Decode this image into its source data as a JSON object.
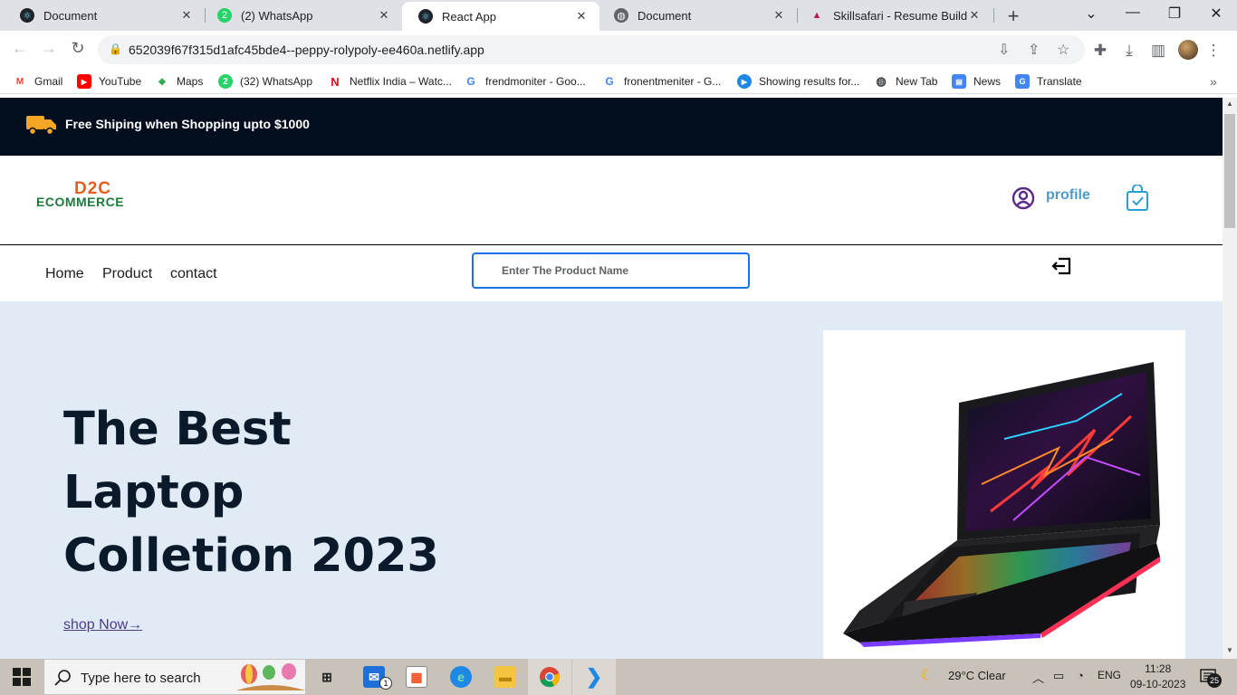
{
  "browser": {
    "tabs": [
      {
        "label": "Document",
        "favicon": "react-icon",
        "active": false
      },
      {
        "label": "(2) WhatsApp",
        "favicon": "whatsapp-icon",
        "active": false
      },
      {
        "label": "React App",
        "favicon": "react-icon",
        "active": true
      },
      {
        "label": "Document",
        "favicon": "globe-icon",
        "active": false
      },
      {
        "label": "Skillsafari - Resume Builder",
        "favicon": "skillsafari-icon",
        "active": false
      }
    ],
    "url": "652039f67f315d1afc45bde4--peppy-rolypoly-ee460a.netlify.app",
    "bookmarks": [
      {
        "label": "Gmail",
        "icon": "gmail-icon"
      },
      {
        "label": "YouTube",
        "icon": "youtube-icon"
      },
      {
        "label": "Maps",
        "icon": "maps-icon"
      },
      {
        "label": "(32) WhatsApp",
        "icon": "whatsapp-icon"
      },
      {
        "label": "Netflix India – Watc...",
        "icon": "netflix-icon"
      },
      {
        "label": "frendmoniter - Goo...",
        "icon": "google-icon"
      },
      {
        "label": "fronentmeniter - G...",
        "icon": "google-icon"
      },
      {
        "label": "Showing results for...",
        "icon": "play-icon"
      },
      {
        "label": "New Tab",
        "icon": "globe-icon"
      },
      {
        "label": "News",
        "icon": "news-icon"
      },
      {
        "label": "Translate",
        "icon": "translate-icon"
      }
    ]
  },
  "page": {
    "promo_text": "Free Shiping when Shopping upto $1000",
    "logo": {
      "top": "D2C",
      "bottom": "ECOMMERCE"
    },
    "profile_label": "profile",
    "nav": [
      "Home",
      "Product",
      "contact"
    ],
    "search_placeholder": "Enter The Product Name",
    "hero": {
      "title_lines": [
        "The Best",
        "Laptop",
        "Colletion 2023"
      ],
      "cta": "shop Now→"
    }
  },
  "taskbar": {
    "search_placeholder": "Type here to search",
    "weather": "29°C  Clear",
    "language": "ENG",
    "time": "11:28",
    "date": "09-10-2023",
    "notification_count": "25",
    "mail_badge": "1"
  },
  "colors": {
    "promo_bg": "#020e1d",
    "hero_bg": "#e1ebf5",
    "accent_blue": "#4d9bc7",
    "search_border": "#1a73e8",
    "logo_orange": "#e85d1c",
    "logo_green": "#1e7a3a"
  }
}
